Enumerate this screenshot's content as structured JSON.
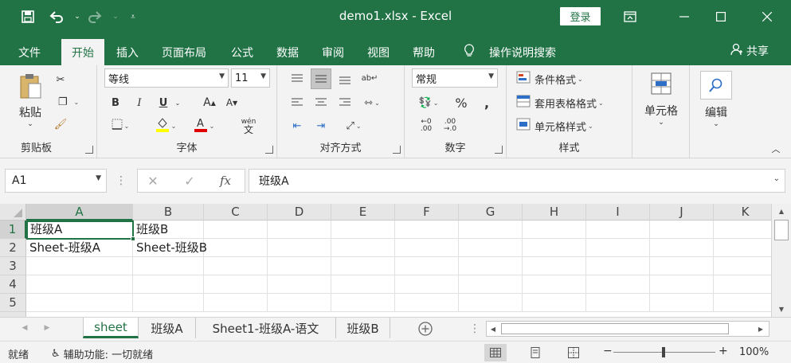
{
  "titlebar": {
    "title": "demo1.xlsx  -  Excel",
    "login": "登录",
    "save_icon": "save-icon",
    "undo_icon": "undo-icon",
    "redo_icon": "redo-icon"
  },
  "menu": {
    "tabs": [
      "文件",
      "开始",
      "插入",
      "页面布局",
      "公式",
      "数据",
      "审阅",
      "视图",
      "帮助"
    ],
    "active": "开始",
    "search": "操作说明搜索",
    "share": "共享"
  },
  "ribbon": {
    "clipboard": {
      "paste": "粘贴",
      "label": "剪贴板"
    },
    "font": {
      "name": "等线",
      "size": "11",
      "bold": "B",
      "italic": "I",
      "underline": "U",
      "grow": "A",
      "shrink": "A",
      "phonetic": "wén",
      "label": "字体"
    },
    "alignment": {
      "label": "对齐方式"
    },
    "number": {
      "format": "常规",
      "percent": "%",
      "comma": ",",
      "label": "数字"
    },
    "styles": {
      "conditional": "条件格式",
      "table": "套用表格格式",
      "cell": "单元格样式",
      "label": "样式"
    },
    "cells": {
      "label": "单元格"
    },
    "editing": {
      "label": "编辑"
    }
  },
  "formula_bar": {
    "name_box": "A1",
    "fx": "fx",
    "content": "班级A"
  },
  "grid": {
    "columns": [
      "A",
      "B",
      "C",
      "D",
      "E",
      "F",
      "G",
      "H",
      "I",
      "J",
      "K"
    ],
    "rows": [
      "1",
      "2",
      "3",
      "4",
      "5"
    ],
    "cells": {
      "A1": "班级A",
      "B1": "班级B",
      "A2": "Sheet-班级A",
      "B2": "Sheet-班级B"
    }
  },
  "sheets": {
    "tabs": [
      "sheet",
      "班级A",
      "Sheet1-班级A-语文",
      "班级B"
    ],
    "active": "sheet"
  },
  "status": {
    "ready": "就绪",
    "accessibility": "辅助功能: 一切就绪",
    "zoom": "100%",
    "minus": "−",
    "plus": "+"
  },
  "colors": {
    "brand": "#217346"
  }
}
